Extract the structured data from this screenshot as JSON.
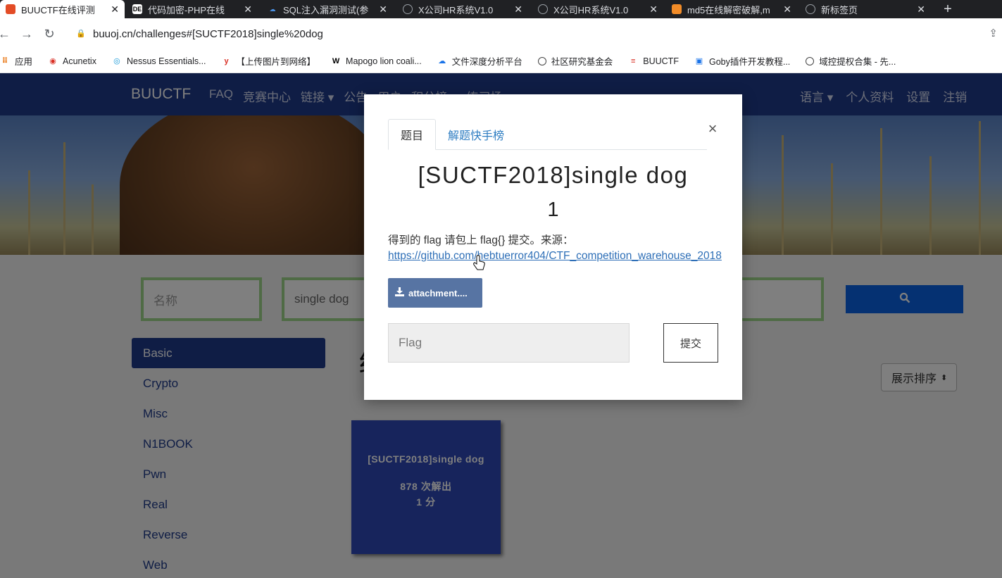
{
  "browser": {
    "tabs": [
      {
        "title": "BUUCTF在线评测",
        "favicon": "doc-icon",
        "active": true
      },
      {
        "title": "代码加密-PHP在线",
        "favicon": "de-icon",
        "active": false
      },
      {
        "title": "SQL注入漏洞测试(参",
        "favicon": "cloud-icon",
        "active": false
      },
      {
        "title": "X公司HR系统V1.0",
        "favicon": "globe-icon",
        "active": false
      },
      {
        "title": "X公司HR系统V1.0",
        "favicon": "globe-icon",
        "active": false
      },
      {
        "title": "md5在线解密破解,m",
        "favicon": "md5-icon",
        "active": false
      },
      {
        "title": "新标签页",
        "favicon": "globe-icon",
        "active": false
      }
    ],
    "tab_close_glyph": "✕",
    "new_tab_glyph": "+",
    "url": "buuoj.cn/challenges#[SUCTF2018]single%20dog",
    "bookmarks": [
      {
        "label": "应用",
        "icon": "apps-icon"
      },
      {
        "label": "Acunetix",
        "icon": "acunetix-icon"
      },
      {
        "label": "Nessus Essentials...",
        "icon": "nessus-icon"
      },
      {
        "label": "【上传图片到网络】",
        "icon": "upload-icon"
      },
      {
        "label": "Mapogo lion coali...",
        "icon": "wikipedia-icon"
      },
      {
        "label": "文件深度分析平台",
        "icon": "cloud-icon"
      },
      {
        "label": "社区研究基金会",
        "icon": "globe-icon"
      },
      {
        "label": "BUUCTF",
        "icon": "buuctf-icon"
      },
      {
        "label": "Goby插件开发教程...",
        "icon": "robot-icon"
      },
      {
        "label": "域控提权合集 - 先...",
        "icon": "globe-icon"
      }
    ]
  },
  "site": {
    "brand": "BUUCTF",
    "nav_links": [
      "FAQ",
      "竞赛中心",
      "链接 ▾",
      "公告",
      "用户",
      "积分榜 ▾",
      "练习场 ▾"
    ],
    "nav_right": [
      "语言 ▾",
      "个人资料",
      "设置",
      "注销"
    ],
    "filter_name_placeholder": "名称",
    "filter_search_value": "single dog",
    "categories": [
      "Basic",
      "Crypto",
      "Misc",
      "N1BOOK",
      "Pwn",
      "Real",
      "Reverse",
      "Web"
    ],
    "active_category": "Basic",
    "results_heading": "结果",
    "sort_label": "展示排序",
    "challenge_card": {
      "title": "[SUCTF2018]single dog",
      "solves": "878 次解出",
      "points": "1 分"
    }
  },
  "modal": {
    "tabs": [
      "题目",
      "解题快手榜"
    ],
    "active_tab": "题目",
    "close_glyph": "×",
    "title": "[SUCTF2018]single dog",
    "value": "1",
    "description": "得到的 flag 请包上 flag{} 提交。来源：",
    "source_link": "https://github.com/hebtuerror404/CTF_competition_warehouse_2018",
    "attachment_label": "attachment....",
    "flag_placeholder": "Flag",
    "submit_label": "提交"
  },
  "colors": {
    "site_nav": "#1f3a8a",
    "search_button": "#0b63e5",
    "card": "#2e49b8",
    "attachment_button": "#5774a3",
    "link": "#2e6fb7"
  }
}
